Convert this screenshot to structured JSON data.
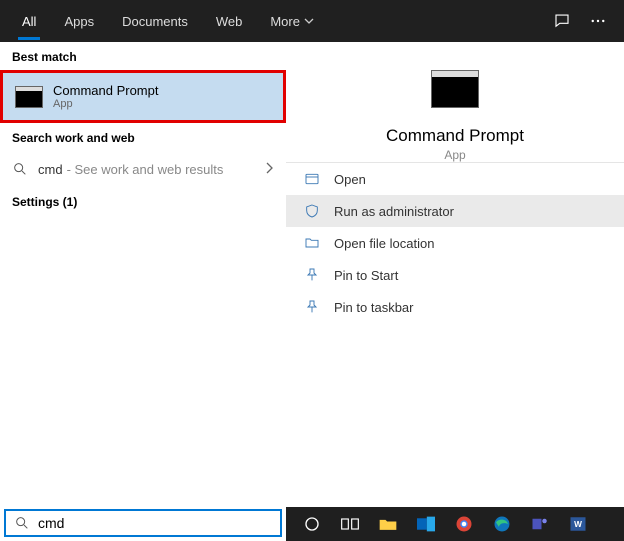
{
  "tabs": {
    "all": "All",
    "apps": "Apps",
    "documents": "Documents",
    "web": "Web",
    "more": "More"
  },
  "left": {
    "best_match_header": "Best match",
    "result_title": "Command Prompt",
    "result_sub": "App",
    "search_web_header": "Search work and web",
    "query": "cmd",
    "query_hint": "- See work and web results",
    "settings": "Settings (1)"
  },
  "preview": {
    "title": "Command Prompt",
    "sub": "App"
  },
  "actions": {
    "open": "Open",
    "run_admin": "Run as administrator",
    "open_loc": "Open file location",
    "pin_start": "Pin to Start",
    "pin_taskbar": "Pin to taskbar"
  },
  "searchbar": {
    "value": "cmd"
  }
}
